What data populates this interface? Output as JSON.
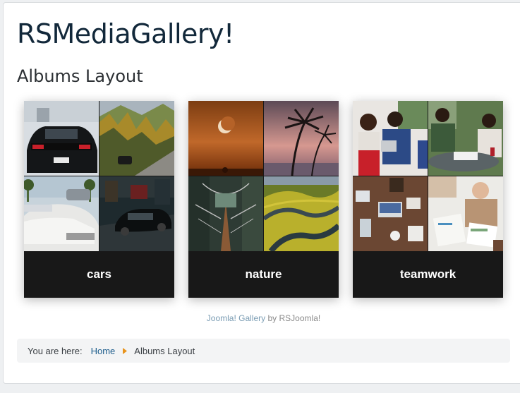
{
  "site": {
    "title": "RSMediaGallery!"
  },
  "page": {
    "title": "Albums Layout"
  },
  "albums": [
    {
      "name": "cars"
    },
    {
      "name": "nature"
    },
    {
      "name": "teamwork"
    }
  ],
  "footer": {
    "credit_link": "Joomla! Gallery",
    "credit_by": "by RSJoomla!"
  },
  "breadcrumb": {
    "prefix": "You are here:",
    "home": "Home",
    "current": "Albums Layout",
    "separator_color": "#e8931c"
  },
  "colors": {
    "title": "#12283a",
    "link": "#1d5d8c",
    "album_caption_bg": "#181818"
  }
}
